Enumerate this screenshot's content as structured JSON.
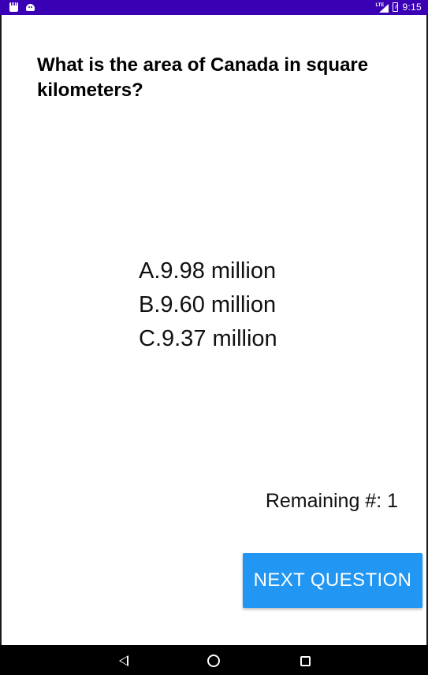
{
  "status_bar": {
    "network_label": "LTE",
    "time": "9:15",
    "background_color": "#3a00b4",
    "icons": [
      "sd-card-icon",
      "android-icon",
      "lte-signal-icon",
      "battery-icon"
    ]
  },
  "quiz": {
    "question": "What is the area of Canada in square kilometers?",
    "answers": [
      {
        "label": "A.9.98 million"
      },
      {
        "label": "B.9.60 million"
      },
      {
        "label": "C.9.37 million"
      }
    ],
    "remaining": "Remaining #: 1",
    "next_button_label": "NEXT QUESTION",
    "accent_color": "#2196f3"
  },
  "nav_bar": {
    "icons": [
      "back-icon",
      "home-icon",
      "recent-apps-icon"
    ]
  }
}
